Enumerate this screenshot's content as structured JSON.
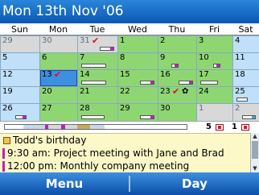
{
  "title": "Mon 13th Nov '06",
  "weekdays": [
    "Sun",
    "Mon",
    "Tue",
    "Wed",
    "Thu",
    "Fri",
    "Sat"
  ],
  "weeks": [
    {
      "days": [
        {
          "n": "29",
          "type": "othermonth"
        },
        {
          "n": "30",
          "type": "othermonth"
        },
        {
          "n": "31",
          "type": "othermonth",
          "tick": true,
          "bar": {
            "from": 0.55,
            "to": 1.0,
            "fill": "#c020c0"
          }
        },
        {
          "n": "1",
          "type": "busy"
        },
        {
          "n": "2",
          "type": "busy"
        },
        {
          "n": "3",
          "type": "busy"
        },
        {
          "n": "4",
          "type": "weekend"
        }
      ]
    },
    {
      "days": [
        {
          "n": "5",
          "type": "weekend"
        },
        {
          "n": "6",
          "type": "busy"
        },
        {
          "n": "7",
          "type": "busy",
          "bar": {
            "from": 0.0,
            "to": 0.75,
            "fill": ""
          }
        },
        {
          "n": "8",
          "type": "busy"
        },
        {
          "n": "9",
          "type": "busy",
          "bar": {
            "from": 0.3,
            "to": 0.55,
            "fill": "#c020c0"
          }
        },
        {
          "n": "10",
          "type": "busy",
          "bar": {
            "from": 0.45,
            "to": 0.7,
            "fill": "#c020c0"
          }
        },
        {
          "n": "11",
          "type": "weekend"
        }
      ]
    },
    {
      "days": [
        {
          "n": "12",
          "type": "weekend"
        },
        {
          "n": "13",
          "type": "selected",
          "tick": true
        },
        {
          "n": "14",
          "type": "busy",
          "bar": {
            "from": 0.0,
            "to": 0.75,
            "fill": ""
          }
        },
        {
          "n": "15",
          "type": "busy",
          "bar": {
            "from": 0.55,
            "to": 1.0,
            "fill": "#c020c0"
          }
        },
        {
          "n": "16",
          "type": "busy",
          "bar": {
            "from": 0.55,
            "to": 1.0,
            "fill": "#c020c0"
          }
        },
        {
          "n": "17",
          "type": "busy",
          "bar": {
            "from": 0.0,
            "to": 0.6,
            "fill": ""
          }
        },
        {
          "n": "18",
          "type": "weekend"
        }
      ]
    },
    {
      "days": [
        {
          "n": "19",
          "type": "weekend"
        },
        {
          "n": "20",
          "type": "busy"
        },
        {
          "n": "21",
          "type": "busy"
        },
        {
          "n": "22",
          "type": "busy"
        },
        {
          "n": "23",
          "type": "busy",
          "tick": true,
          "flower": true
        },
        {
          "n": "24",
          "type": "busy"
        },
        {
          "n": "25",
          "type": "weekend",
          "bar": {
            "from": 0.0,
            "to": 0.6,
            "fill": ""
          }
        }
      ]
    },
    {
      "days": [
        {
          "n": "26",
          "type": "weekend",
          "bar": {
            "from": 0.35,
            "to": 0.7,
            "fill": "#c020c0"
          }
        },
        {
          "n": "27",
          "type": "busy"
        },
        {
          "n": "28",
          "type": "busy",
          "bar": {
            "from": 0.0,
            "to": 0.7,
            "fill": ""
          }
        },
        {
          "n": "29",
          "type": "busy",
          "bar": {
            "from": 0.55,
            "to": 1.0,
            "fill": "#c020c0"
          }
        },
        {
          "n": "30",
          "type": "busy"
        },
        {
          "n": "1",
          "type": "othermonth"
        },
        {
          "n": "2",
          "type": "othermonth",
          "bar": {
            "from": 0.3,
            "to": 1.0,
            "fill": "#2fb4d8"
          }
        }
      ]
    }
  ],
  "timeline": {
    "segments": [
      {
        "from": 0.1,
        "to": 0.22,
        "color": "#c7d9e8"
      },
      {
        "from": 0.22,
        "to": 0.24,
        "color": "#c020c0"
      },
      {
        "from": 0.24,
        "to": 0.31,
        "color": "#d8d8d8"
      },
      {
        "from": 0.31,
        "to": 0.33,
        "color": "#c020c0"
      },
      {
        "from": 0.33,
        "to": 0.4,
        "color": "#d8d8d8"
      },
      {
        "from": 0.4,
        "to": 0.47,
        "color": "#c8a85a"
      },
      {
        "from": 0.47,
        "to": 0.55,
        "color": "#c7d9e8"
      }
    ],
    "count_events": "5",
    "count_todos": "1"
  },
  "events": [
    {
      "kind": "bday",
      "text": "Todd's birthday",
      "color": "#f3c24c"
    },
    {
      "kind": "meeting",
      "text": "9:30 am: Project meeting with Jane and Brad",
      "color": "#c020c0"
    },
    {
      "kind": "meeting",
      "text": "12:00 pm: Monthly company meeting",
      "color": "#c020c0"
    }
  ],
  "softkeys": {
    "left": "Menu",
    "right": "Day"
  },
  "colors": {
    "busy": "#8ed672",
    "weekend": "#bfe0f8",
    "othermonth": "#d8d8d8",
    "selected": "#3f8fe0",
    "titlebar": "#0b57b4"
  }
}
